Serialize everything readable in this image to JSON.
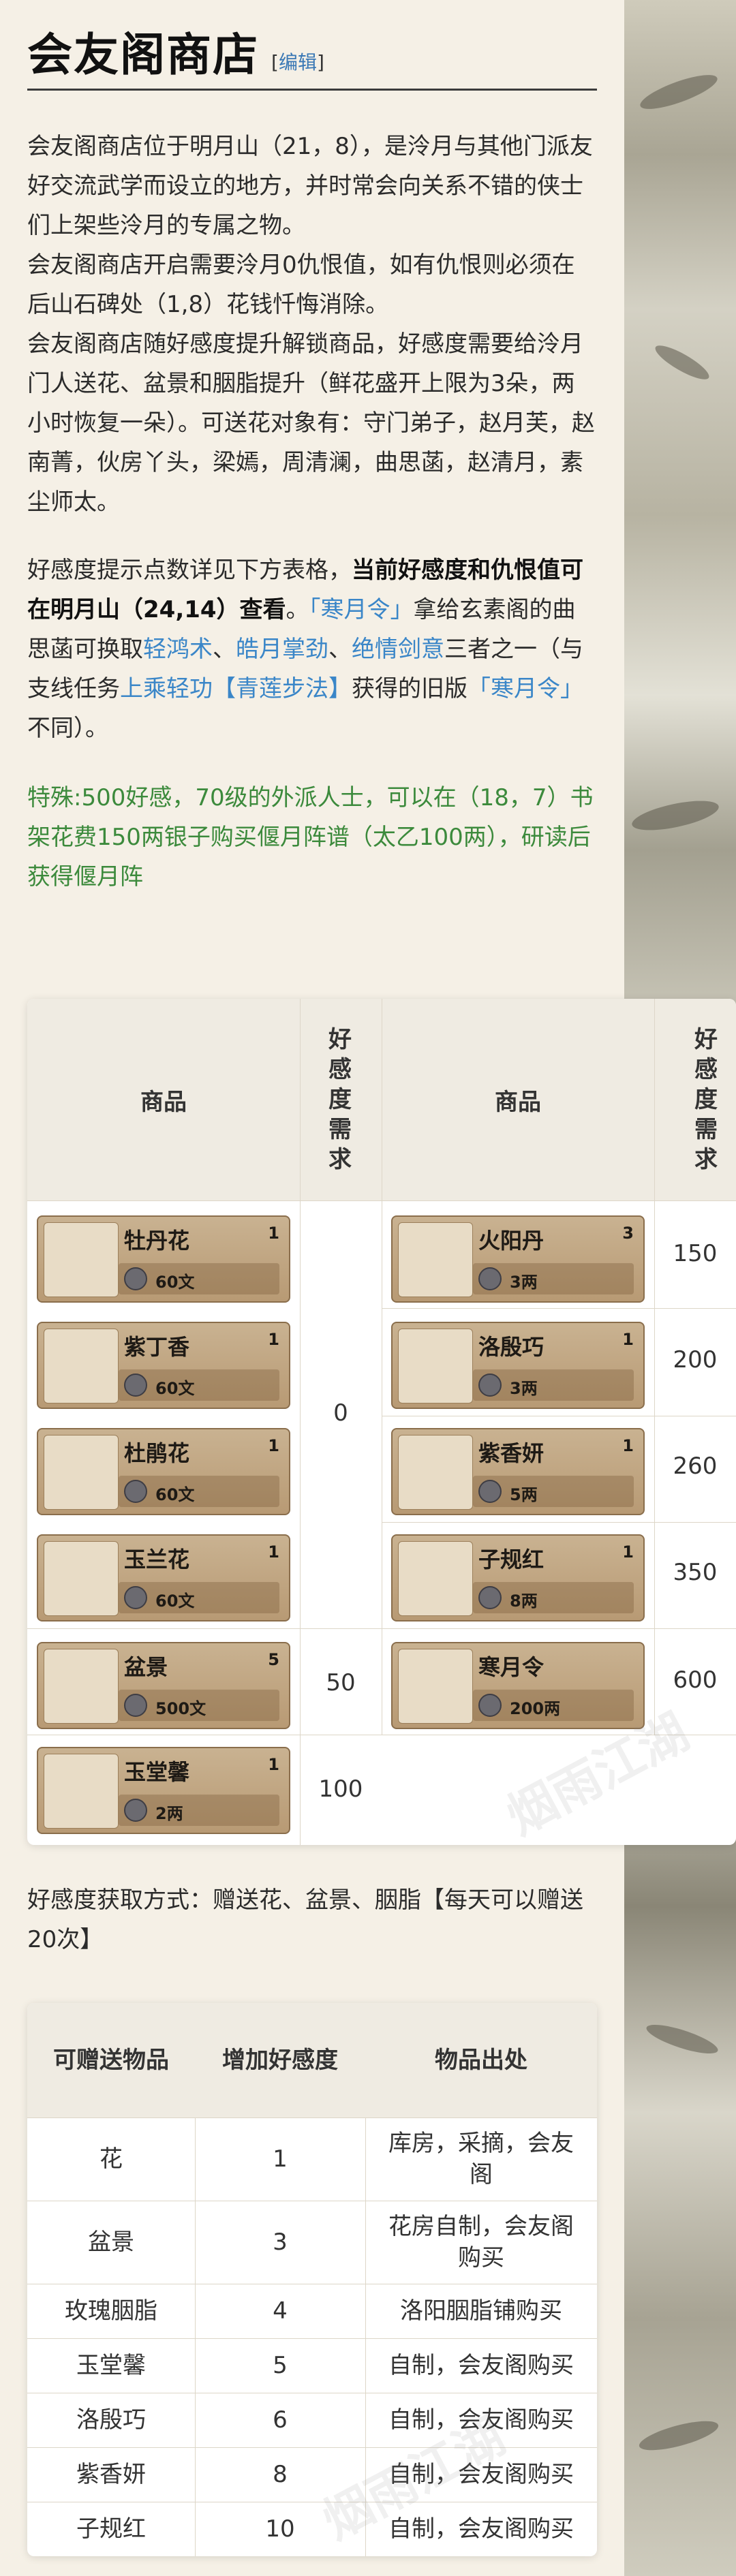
{
  "page": {
    "title": "会友阁商店",
    "edit_label": "编辑",
    "edit_bracket_open": "[",
    "edit_bracket_close": "]"
  },
  "intro": {
    "p1": "会友阁商店位于明月山（21，8），是泠月与其他门派友好交流武学而设立的地方，并时常会向关系不错的侠士们上架些泠月的专属之物。",
    "p2": "会友阁商店开启需要泠月0仇恨值，如有仇恨则必须在后山石碑处（1,8）花钱忏悔消除。",
    "p3": "会友阁商店随好感度提升解锁商品，好感度需要给泠月门人送花、盆景和胭脂提升（鲜花盛开上限为3朵，两小时恢复一朵）。可送花对象有：守门弟子，赵月芙，赵南菁，伙房丫头，梁嫣，周清澜，曲思菡，赵清月，素尘师太。",
    "p4_a": "好感度提示点数详见下方表格，",
    "p4_bold": "当前好感度和仇恨值可在明月山（24,14）查看",
    "p4_b": "。",
    "p4_link1": "「寒月令」",
    "p4_c": "拿给玄素阁的曲思菡可换取",
    "p4_link2": "轻鸿术",
    "p4_sep1": "、",
    "p4_link3": "皓月掌劲",
    "p4_sep2": "、",
    "p4_link4": "绝情剑意",
    "p4_d": "三者之一（与支线任务",
    "p4_link5": "上乘轻功【青莲步法】",
    "p4_e": "获得的旧版",
    "p4_link6": "「寒月令」",
    "p4_f": "不同）。",
    "special": "特殊:500好感，70级的外派人士，可以在（18，7）书架花费150两银子购买偃月阵谱（太乙100两），研读后获得偃月阵"
  },
  "shop_table": {
    "headers": {
      "item": "商品",
      "req": "好感度需求"
    },
    "left_items": [
      {
        "name": "牡丹花",
        "qty": "1",
        "price": "60文"
      },
      {
        "name": "紫丁香",
        "qty": "1",
        "price": "60文"
      },
      {
        "name": "杜鹃花",
        "qty": "1",
        "price": "60文"
      },
      {
        "name": "玉兰花",
        "qty": "1",
        "price": "60文"
      },
      {
        "name": "盆景",
        "qty": "5",
        "price": "500文"
      },
      {
        "name": "玉堂馨",
        "qty": "1",
        "price": "2两"
      }
    ],
    "left_reqs": [
      "0",
      "50",
      "100"
    ],
    "right_items": [
      {
        "name": "火阳丹",
        "qty": "3",
        "price": "3两",
        "req": "150"
      },
      {
        "name": "洛殷巧",
        "qty": "1",
        "price": "3两",
        "req": "200"
      },
      {
        "name": "紫香妍",
        "qty": "1",
        "price": "5两",
        "req": "260"
      },
      {
        "name": "子规红",
        "qty": "1",
        "price": "8两",
        "req": "350"
      },
      {
        "name": "寒月令",
        "qty": "",
        "price": "200两",
        "req": "600"
      }
    ],
    "watermark": "烟雨江湖"
  },
  "gift_intro": "好感度获取方式：赠送花、盆景、胭脂【每天可以赠送20次】",
  "gift_table": {
    "headers": [
      "可赠送物品",
      "增加好感度",
      "物品出处"
    ],
    "rows": [
      [
        "花",
        "1",
        "库房，采摘，会友阁"
      ],
      [
        "盆景",
        "3",
        "花房自制，会友阁购买"
      ],
      [
        "玫瑰胭脂",
        "4",
        "洛阳胭脂铺购买"
      ],
      [
        "玉堂馨",
        "5",
        "自制，会友阁购买"
      ],
      [
        "洛殷巧",
        "6",
        "自制，会友阁购买"
      ],
      [
        "紫香妍",
        "8",
        "自制，会友阁购买"
      ],
      [
        "子规红",
        "10",
        "自制，会友阁购买"
      ]
    ]
  }
}
